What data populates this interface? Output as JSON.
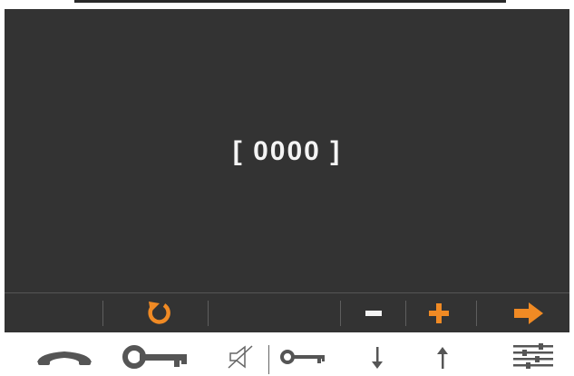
{
  "display": {
    "code_text": "[ 0000 ]"
  },
  "softkeys": [
    {
      "icon": "undo-icon",
      "color": "#f08a24"
    },
    {
      "icon": "minus-icon",
      "color": "#f4f4f4"
    },
    {
      "icon": "plus-icon",
      "color": "#f08a24"
    },
    {
      "icon": "arrow-right-icon",
      "color": "#f08a24"
    }
  ],
  "hardware_buttons": [
    {
      "icon": "hang-up-icon"
    },
    {
      "icon": "key-icon"
    },
    {
      "icon": "mute-icon"
    },
    {
      "icon": "key-small-icon"
    },
    {
      "icon": "arrow-down-icon"
    },
    {
      "icon": "arrow-up-icon"
    },
    {
      "icon": "menu-settings-icon"
    }
  ],
  "colors": {
    "screen_bg": "#333333",
    "accent": "#f08a24",
    "hardware_icon": "#555555"
  }
}
